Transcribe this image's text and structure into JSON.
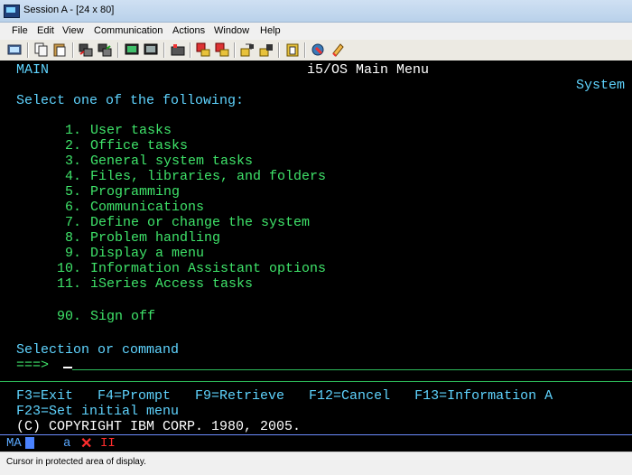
{
  "window": {
    "title": "Session A - [24 x 80]"
  },
  "menu": [
    "File",
    "Edit",
    "View",
    "Communication",
    "Actions",
    "Window",
    "Help"
  ],
  "toolbar_icons": [
    "print-screen-icon",
    "copy-icon",
    "paste-icon",
    "send-icon",
    "receive-icon",
    "display-icon",
    "display-alt-icon",
    "macro-record-icon",
    "macro-play-icon",
    "macro-stop-icon",
    "keyboard-map-icon",
    "edit-macro-icon",
    "clipboard-icon",
    "tools-icon",
    "help-icon"
  ],
  "screen": {
    "panel_id": "MAIN",
    "title": "i5/OS Main Menu",
    "system_label": "System",
    "prompt": "Select one of the following:",
    "options": [
      {
        "num": "1.",
        "text": "User tasks"
      },
      {
        "num": "2.",
        "text": "Office tasks"
      },
      {
        "num": "3.",
        "text": "General system tasks"
      },
      {
        "num": "4.",
        "text": "Files, libraries, and folders"
      },
      {
        "num": "5.",
        "text": "Programming"
      },
      {
        "num": "6.",
        "text": "Communications"
      },
      {
        "num": "7.",
        "text": "Define or change the system"
      },
      {
        "num": "8.",
        "text": "Problem handling"
      },
      {
        "num": "9.",
        "text": "Display a menu"
      },
      {
        "num": "10.",
        "text": "Information Assistant options"
      },
      {
        "num": "11.",
        "text": "iSeries Access tasks"
      },
      {
        "num": "90.",
        "text": "Sign off"
      }
    ],
    "selection_label": "Selection or command",
    "command_prompt": "===>",
    "fkeys_line1": "F3=Exit   F4=Prompt   F9=Retrieve   F12=Cancel   F13=Information A",
    "fkeys_line2": "F23=Set initial menu",
    "copyright": "(C) COPYRIGHT IBM CORP. 1980, 2005."
  },
  "oia": {
    "mode": "MA",
    "a": "a",
    "error_mark": "✕",
    "ii": "II"
  },
  "status": {
    "message": "Cursor in protected area of display."
  }
}
